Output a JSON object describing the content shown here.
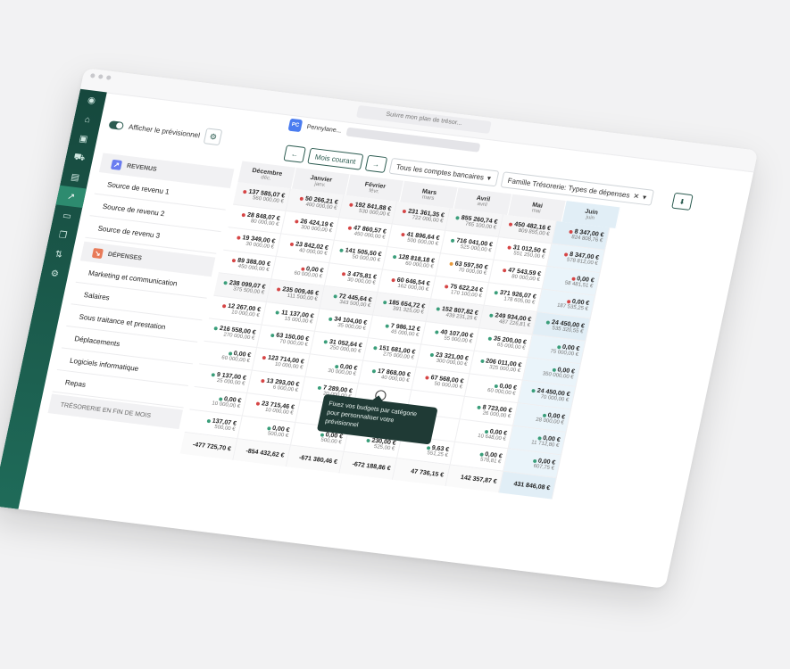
{
  "browser": {
    "url": "Suivre mon plan de trésor..."
  },
  "header": {
    "org_badge": "PC",
    "org_name": "Pennylane..."
  },
  "toggle": {
    "label": "Afficher le prévisionnel"
  },
  "controls": {
    "prev": "←",
    "current": "Mois courant",
    "next": "→",
    "accounts": "Tous les comptes bancaires",
    "family": "Famille Trésorerie: Types de dépenses",
    "download": "⬇"
  },
  "sections": {
    "revenue": "REVENUS",
    "expenses": "DÉPENSES",
    "treasury": "TRÉSORERIE EN FIN DE MOIS"
  },
  "revenue_rows": [
    "Source de revenu 1",
    "Source de revenu 2",
    "Source de revenu 3"
  ],
  "expense_rows": [
    "Marketing et communication",
    "Salaires",
    "Sous traitance et prestation",
    "Déplacements",
    "Logiciels informatique",
    "Repas"
  ],
  "months": [
    {
      "name": "Décembre",
      "abbr": "déc."
    },
    {
      "name": "Janvier",
      "abbr": "janv."
    },
    {
      "name": "Février",
      "abbr": "févr."
    },
    {
      "name": "Mars",
      "abbr": "mars"
    },
    {
      "name": "Avril",
      "abbr": "avril"
    },
    {
      "name": "Mai",
      "abbr": "mai"
    },
    {
      "name": "Juin",
      "abbr": "juin"
    }
  ],
  "revenue_total": [
    {
      "a": "137 585,07 €",
      "b": "560 000,00 €",
      "dot": "r"
    },
    {
      "a": "50 266,21 €",
      "b": "400 000,00 €",
      "dot": "r"
    },
    {
      "a": "192 841,88 €",
      "b": "530 000,00 €",
      "dot": "r"
    },
    {
      "a": "231 361,35 €",
      "b": "722 000,00 €",
      "dot": "r"
    },
    {
      "a": "855 260,74 €",
      "b": "765 100,00 €",
      "dot": "g"
    },
    {
      "a": "450 482,16 €",
      "b": "809 855,00 €",
      "dot": "r"
    },
    {
      "a": "8 347,00 €",
      "b": "824 808,76 €",
      "dot": "r"
    }
  ],
  "revenue_cells": [
    [
      {
        "a": "28 848,07 €",
        "b": "80 000,00 €",
        "dot": "r"
      },
      {
        "a": "26 424,19 €",
        "b": "300 000,00 €",
        "dot": "r"
      },
      {
        "a": "47 860,57 €",
        "b": "450 000,00 €",
        "dot": "r"
      },
      {
        "a": "41 896,64 €",
        "b": "500 000,00 €",
        "dot": "r"
      },
      {
        "a": "716 041,00 €",
        "b": "525 000,00 €",
        "dot": "g"
      },
      {
        "a": "31 012,50 €",
        "b": "551 250,00 €",
        "dot": "r"
      },
      {
        "a": "8 347,00 €",
        "b": "578 812,00 €",
        "dot": "r"
      }
    ],
    [
      {
        "a": "19 349,00 €",
        "b": "30 000,00 €",
        "dot": "r"
      },
      {
        "a": "23 842,02 €",
        "b": "40 000,00 €",
        "dot": "r"
      },
      {
        "a": "141 505,50 €",
        "b": "50 000,00 €",
        "dot": "g"
      },
      {
        "a": "128 818,18 €",
        "b": "60 000,00 €",
        "dot": "g"
      },
      {
        "a": "63 597,50 €",
        "b": "70 000,00 €",
        "dot": "o"
      },
      {
        "a": "47 543,59 €",
        "b": "80 000,00 €",
        "dot": "r"
      },
      {
        "a": "0,00 €",
        "b": "58 481,51 €",
        "dot": "r"
      }
    ],
    [
      {
        "a": "89 388,00 €",
        "b": "450 000,00 €",
        "dot": "r"
      },
      {
        "a": "0,00 €",
        "b": "60 000,00 €",
        "dot": "r"
      },
      {
        "a": "3 475,81 €",
        "b": "30 000,00 €",
        "dot": "r"
      },
      {
        "a": "60 646,54 €",
        "b": "162 000,00 €",
        "dot": "r"
      },
      {
        "a": "75 622,24 €",
        "b": "170 100,00 €",
        "dot": "r"
      },
      {
        "a": "371 926,07 €",
        "b": "178 605,00 €",
        "dot": "g"
      },
      {
        "a": "0,00 €",
        "b": "187 535,25 €",
        "dot": "r"
      }
    ]
  ],
  "expense_total": [
    {
      "a": "238 099,07 €",
      "b": "375 500,00 €",
      "dot": "g"
    },
    {
      "a": "235 009,46 €",
      "b": "111 500,00 €",
      "dot": "r"
    },
    {
      "a": "72 445,64 €",
      "b": "343 500,00 €",
      "dot": "g"
    },
    {
      "a": "185 654,72 €",
      "b": "391 325,00 €",
      "dot": "g"
    },
    {
      "a": "152 807,82 €",
      "b": "439 231,25 €",
      "dot": "g"
    },
    {
      "a": "249 934,00 €",
      "b": "487 226,81 €",
      "dot": "g"
    },
    {
      "a": "24 450,00 €",
      "b": "535 320,55 €",
      "dot": "g"
    }
  ],
  "expense_cells": [
    [
      {
        "a": "12 267,00 €",
        "b": "10 000,00 €",
        "dot": "r"
      },
      {
        "a": "11 137,00 €",
        "b": "15 000,00 €",
        "dot": "g"
      },
      {
        "a": "34 104,00 €",
        "b": "35 000,00 €",
        "dot": "g"
      },
      {
        "a": "7 986,12 €",
        "b": "45 000,00 €",
        "dot": "g"
      },
      {
        "a": "40 107,00 €",
        "b": "55 000,00 €",
        "dot": "g"
      },
      {
        "a": "35 200,00 €",
        "b": "65 000,00 €",
        "dot": "g"
      },
      {
        "a": "0,00 €",
        "b": "75 000,00 €",
        "dot": "g"
      }
    ],
    [
      {
        "a": "216 558,00 €",
        "b": "270 000,00 €",
        "dot": "g"
      },
      {
        "a": "63 150,00 €",
        "b": "70 000,00 €",
        "dot": "g"
      },
      {
        "a": "31 052,64 €",
        "b": "250 000,00 €",
        "dot": "g"
      },
      {
        "a": "151 681,00 €",
        "b": "275 000,00 €",
        "dot": "g"
      },
      {
        "a": "23 321,00 €",
        "b": "300 000,00 €",
        "dot": "g"
      },
      {
        "a": "206 011,00 €",
        "b": "325 000,00 €",
        "dot": "g"
      },
      {
        "a": "0,00 €",
        "b": "350 000,00 €",
        "dot": "g"
      }
    ],
    [
      {
        "a": "0,00 €",
        "b": "60 000,00 €",
        "dot": "g"
      },
      {
        "a": "123 714,00 €",
        "b": "10 000,00 €",
        "dot": "r"
      },
      {
        "a": "0,00 €",
        "b": "30 000,00 €",
        "dot": "g"
      },
      {
        "a": "17 868,00 €",
        "b": "40 000,00 €",
        "dot": "g"
      },
      {
        "a": "67 568,00 €",
        "b": "50 000,00 €",
        "dot": "r"
      },
      {
        "a": "0,00 €",
        "b": "60 000,00 €",
        "dot": "g"
      },
      {
        "a": "24 450,00 €",
        "b": "70 000,00 €",
        "dot": "g"
      }
    ],
    [
      {
        "a": "9 137,00 €",
        "b": "25 000,00 €",
        "dot": "g"
      },
      {
        "a": "13 293,00 €",
        "b": "6 000,00 €",
        "dot": "r"
      },
      {
        "a": "7 289,00 €",
        "b": "20 000,00 €",
        "dot": "g"
      },
      {
        "a": "",
        "b": "",
        "dot": ""
      },
      {
        "a": "",
        "b": "",
        "dot": ""
      },
      {
        "a": "8 723,00 €",
        "b": "26 000,00 €",
        "dot": "g"
      },
      {
        "a": "0,00 €",
        "b": "28 000,00 €",
        "dot": "g"
      }
    ],
    [
      {
        "a": "0,00 €",
        "b": "10 000,00 €",
        "dot": "g"
      },
      {
        "a": "23 715,46 €",
        "b": "10 000,00 €",
        "dot": "r"
      },
      {
        "a": "0,00 €",
        "b": "8 000,00 €",
        "dot": "g"
      },
      {
        "a": "",
        "b": "",
        "dot": ""
      },
      {
        "a": "",
        "b": "",
        "dot": ""
      },
      {
        "a": "0,00 €",
        "b": "10 648,00 €",
        "dot": "g"
      },
      {
        "a": "0,00 €",
        "b": "11 712,80 €",
        "dot": "g"
      }
    ],
    [
      {
        "a": "137,07 €",
        "b": "500,00 €",
        "dot": "g"
      },
      {
        "a": "0,00 €",
        "b": "500,00 €",
        "dot": "g"
      },
      {
        "a": "0,00 €",
        "b": "500,00 €",
        "dot": "g"
      },
      {
        "a": "230,00 €",
        "b": "525,00 €",
        "dot": "g"
      },
      {
        "a": "9,63 €",
        "b": "551,25 €",
        "dot": "g"
      },
      {
        "a": "0,00 €",
        "b": "578,81 €",
        "dot": "g"
      },
      {
        "a": "0,00 €",
        "b": "607,75 €",
        "dot": "g"
      }
    ]
  ],
  "treasury": [
    "-477 725,70 €",
    "-854 432,62 €",
    "-671 380,46 €",
    "-672 188,86 €",
    "47 736,15 €",
    "142 357,87 €",
    "431 846,08 €"
  ],
  "tooltip": "Fixez vos budgets par catégorie pour personnaliser votre prévisionnel"
}
